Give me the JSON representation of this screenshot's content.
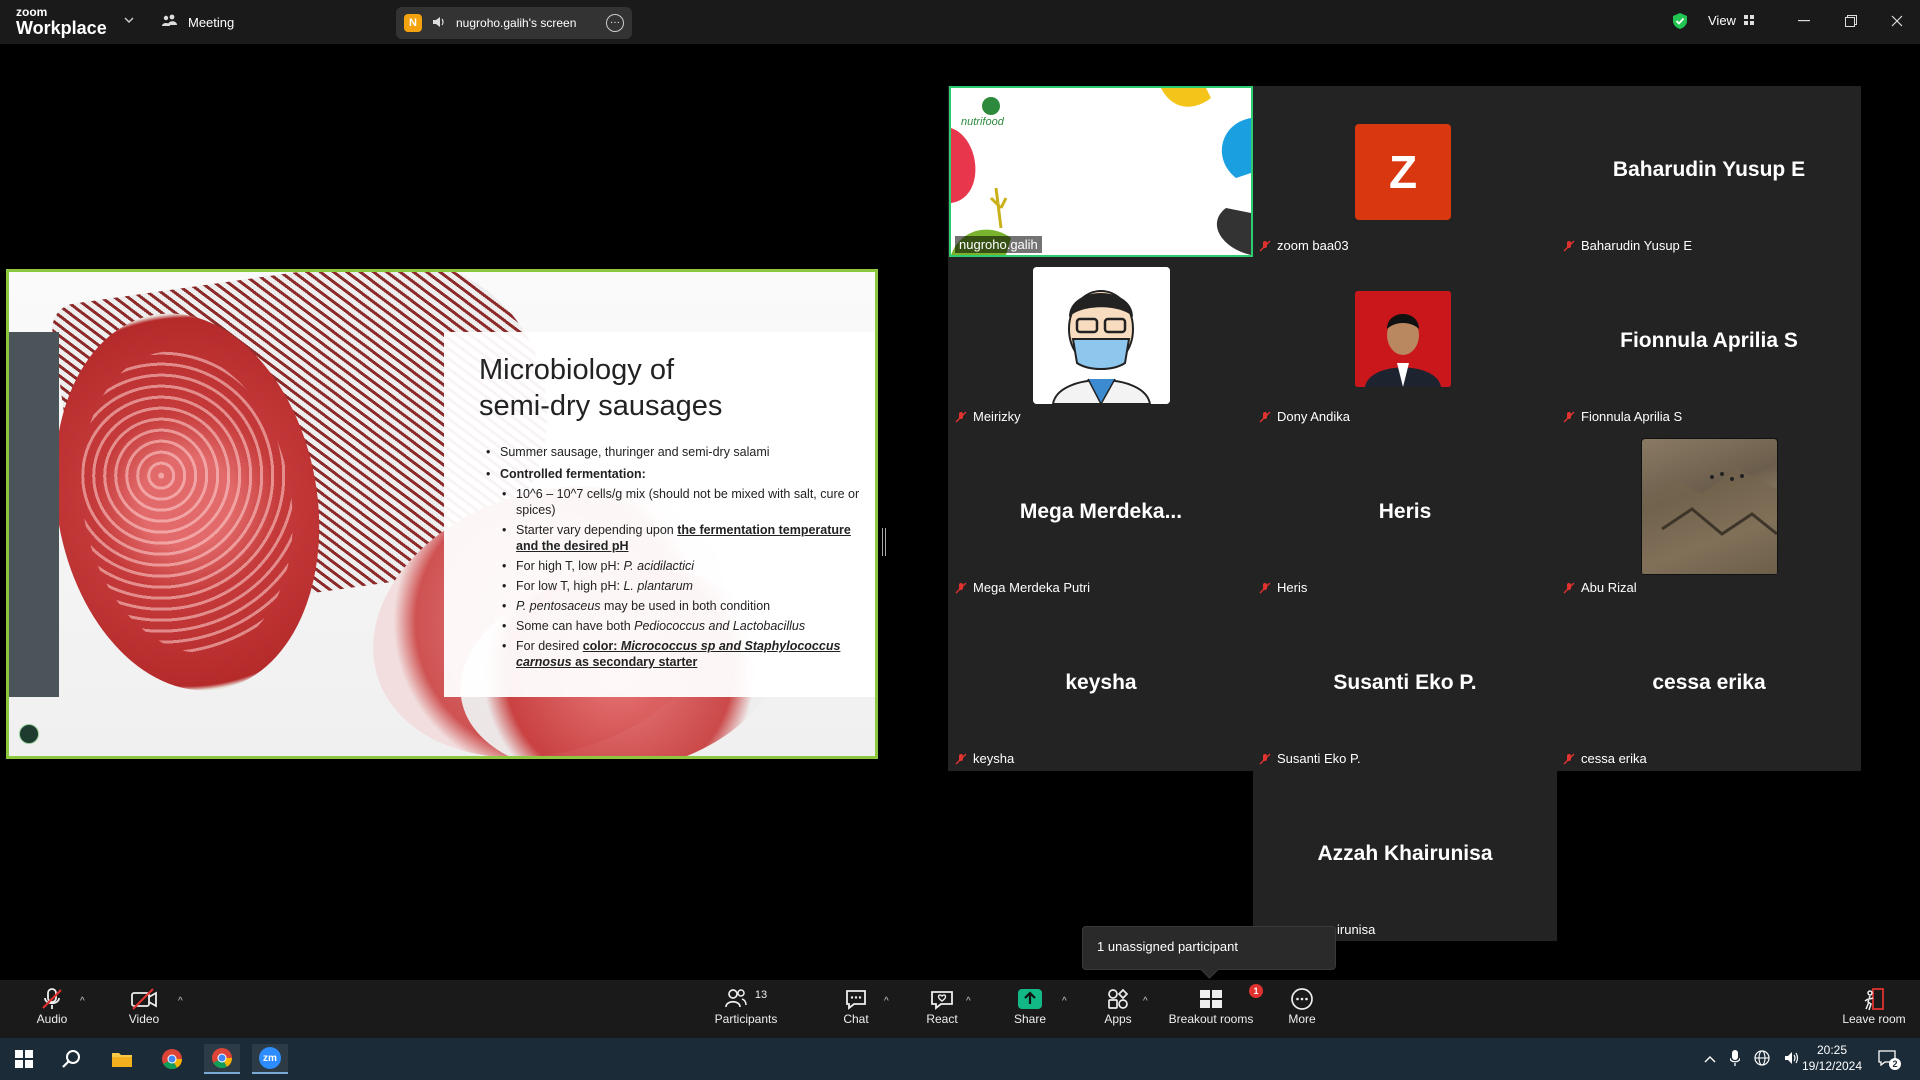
{
  "titlebar": {
    "logo_small": "zoom",
    "logo_big": "Workplace",
    "meeting_label": "Meeting",
    "share_avatar_letter": "N",
    "screen_label": "nugroho.galih's screen",
    "view_label": "View"
  },
  "slide": {
    "title_line1": "Microbiology of",
    "title_line2": "semi-dry sausages",
    "bullet1": "Summer sausage, thuringer and semi-dry salami",
    "bullet2": "Controlled fermentation:",
    "sub1": "10^6 – 10^7 cells/g mix (should not be mixed with salt, cure or spices)",
    "sub2_pre": "Starter vary depending upon ",
    "sub2_link": "the fermentation temperature and the desired pH",
    "sub3_pre": "For high T, low pH: ",
    "sub3_it": "P. acidilactici",
    "sub4_pre": "For low T, high pH: ",
    "sub4_it": "L. plantarum",
    "sub5_it": "P. pentosaceus",
    "sub5_post": " may be used in both condition",
    "sub6_pre": "Some can have both ",
    "sub6_it": "Pediococcus and Lactobacillus",
    "sub7_pre": "For desired ",
    "sub7_link1": "color: ",
    "sub7_link_it": "Micrococcus sp and Staphylococcus carnosus",
    "sub7_link2": " as secondary starter"
  },
  "gallery": {
    "tiles": [
      {
        "label": "nugroho.galih",
        "big": "",
        "brand": "nutrifood"
      },
      {
        "label": "zoom baa03",
        "big": "",
        "avatar": "Z"
      },
      {
        "label": "Baharudin Yusup E",
        "big": "Baharudin Yusup E"
      },
      {
        "label": "Meirizky",
        "big": ""
      },
      {
        "label": "Dony Andika",
        "big": ""
      },
      {
        "label": "Fionnula Aprilia S",
        "big": "Fionnula Aprilia S"
      },
      {
        "label": "Mega Merdeka Putri",
        "big": "Mega Merdeka..."
      },
      {
        "label": "Heris",
        "big": "Heris"
      },
      {
        "label": "Abu Rizal",
        "big": ""
      },
      {
        "label": "keysha",
        "big": "keysha"
      },
      {
        "label": "Susanti Eko P.",
        "big": "Susanti Eko P."
      },
      {
        "label": "cessa erika",
        "big": "cessa erika"
      },
      {
        "label": "irunisa",
        "big": "Azzah Khairunisa"
      }
    ]
  },
  "tooltip": "1 unassigned participant",
  "toolbar": {
    "audio": "Audio",
    "video": "Video",
    "participants": "Participants",
    "participants_count": "13",
    "chat": "Chat",
    "react": "React",
    "share": "Share",
    "apps": "Apps",
    "breakout": "Breakout rooms",
    "breakout_badge": "1",
    "more": "More",
    "leave": "Leave room"
  },
  "taskbar": {
    "time": "20:25",
    "date": "19/12/2024",
    "notif_count": "2",
    "zoom_label": "zm"
  },
  "colors": {
    "active_speaker": "#2ecc71",
    "slide_border": "#8dc63f",
    "share_green": "#12b886",
    "zoom_red": "#d9370f",
    "badge_red": "#e0322f"
  }
}
